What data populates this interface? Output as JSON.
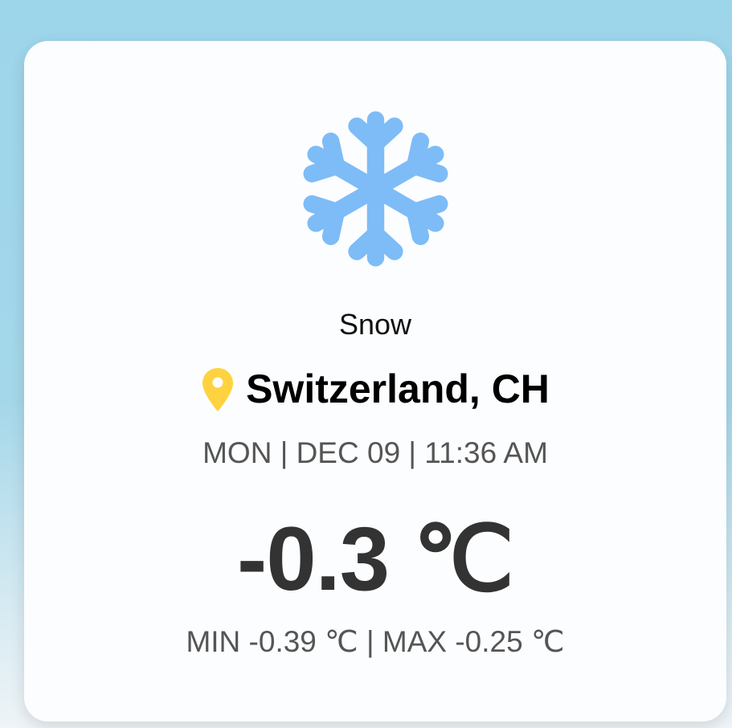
{
  "weather": {
    "icon": "snowflake-icon",
    "icon_color": "#7dbcf7",
    "condition": "Snow",
    "location_icon": "map-pin-icon",
    "location_icon_color": "#ffd23f",
    "location": "Switzerland, CH",
    "datetime": "MON | DEC 09 | 11:36 AM",
    "temperature": "-0.3 ℃",
    "min_label": "MIN -0.39 ",
    "min_unit": "℃",
    "separator": " | ",
    "max_label": "MAX -0.25 ",
    "max_unit": "℃"
  },
  "colors": {
    "background": "#9dd5ea",
    "card": "#fcfdfe",
    "text_primary": "#000000",
    "text_secondary": "#555555",
    "temperature": "#333333"
  }
}
